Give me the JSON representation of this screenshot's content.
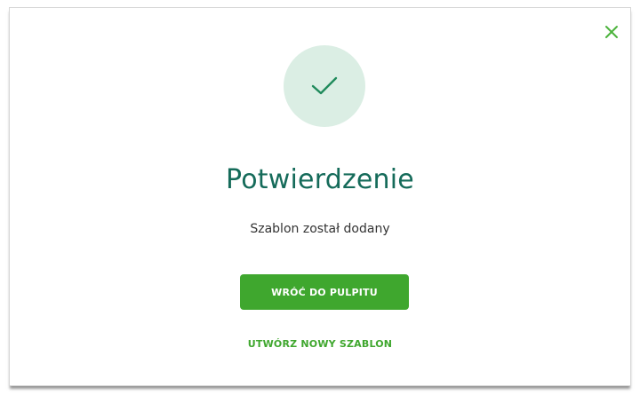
{
  "colors": {
    "accent_green": "#3fa72e",
    "title_green": "#156b5a",
    "check_green": "#1f8a5b",
    "circle_bg": "#dbeee4",
    "close_green": "#4db33d"
  },
  "dialog": {
    "close_icon": "close-icon",
    "success_icon": "checkmark-icon",
    "title": "Potwierdzenie",
    "message": "Szablon został dodany",
    "primary_button_label": "WRÓĆ DO PULPITU",
    "secondary_link_label": "UTWÓRZ NOWY SZABLON"
  }
}
